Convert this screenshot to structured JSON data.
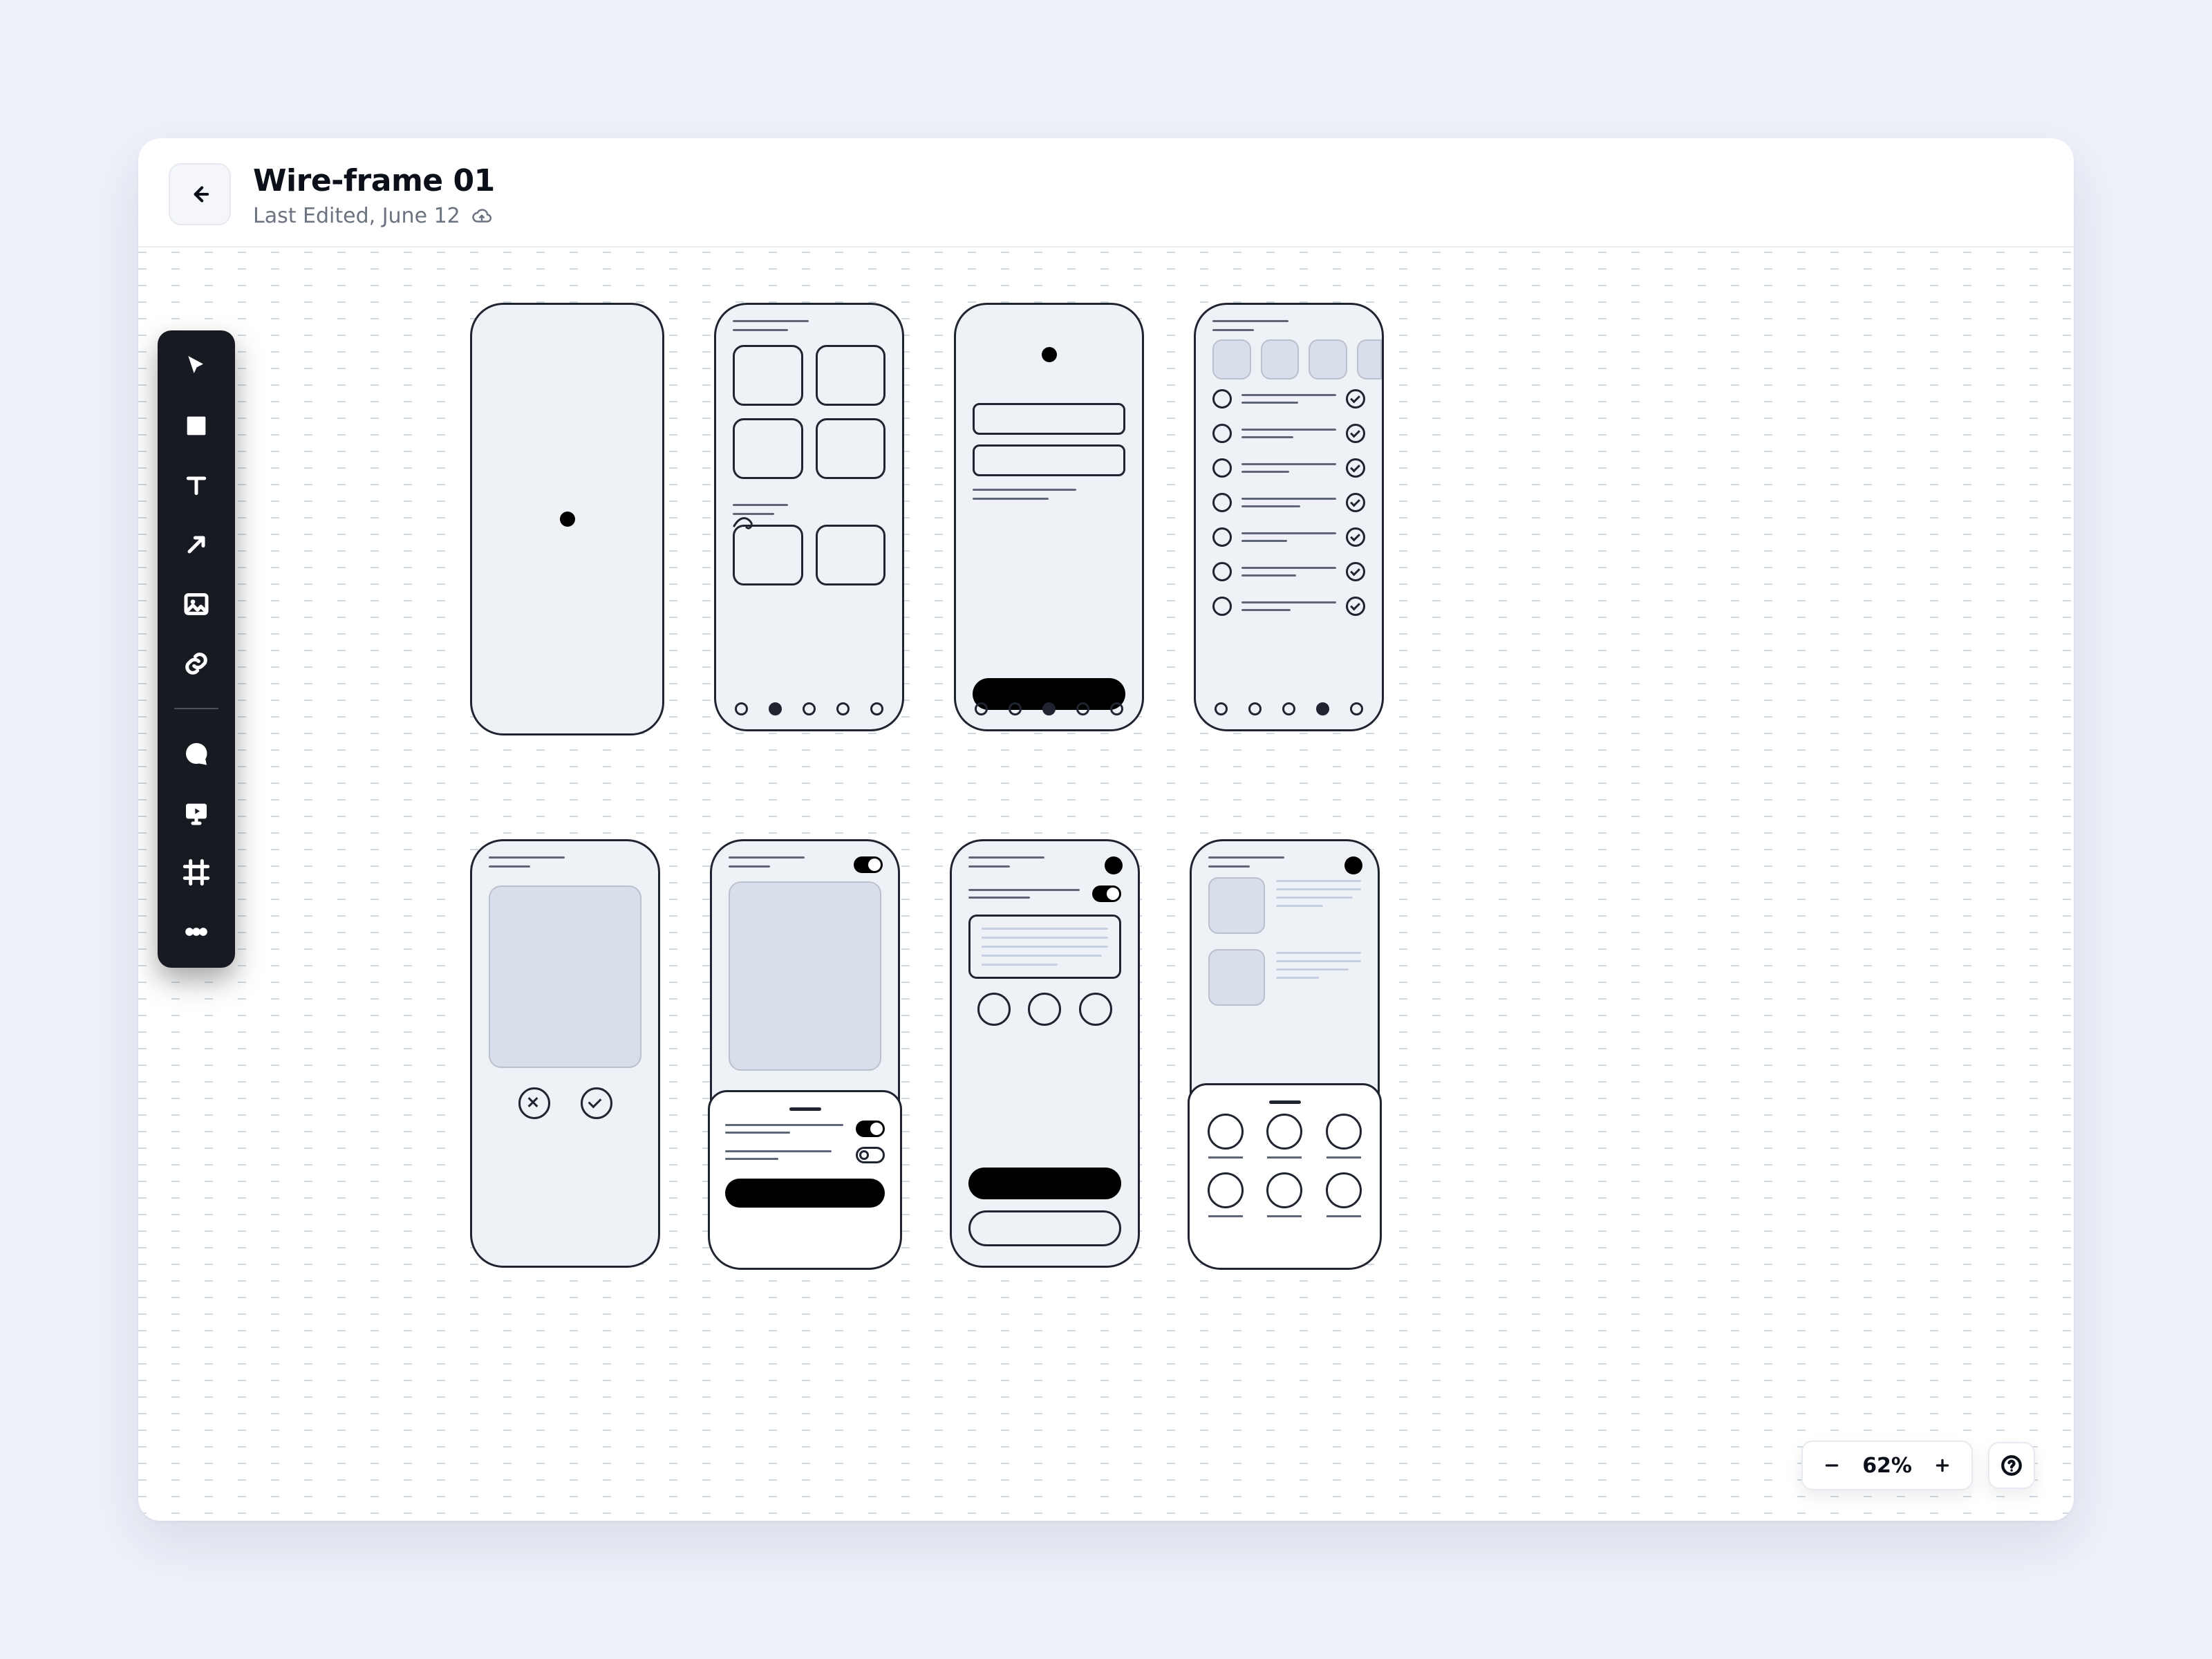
{
  "header": {
    "title": "Wire-frame 01",
    "subtitle": "Last Edited, June 12",
    "sync_icon": "cloud-upload-icon",
    "back_icon": "arrow-left-icon"
  },
  "toolbar": {
    "tools": [
      {
        "name": "select-tool",
        "icon": "cursor-arrow-icon"
      },
      {
        "name": "rectangle-tool",
        "icon": "square-icon"
      },
      {
        "name": "text-tool",
        "icon": "text-t-icon"
      },
      {
        "name": "arrow-tool",
        "icon": "arrow-upright-icon"
      },
      {
        "name": "image-tool",
        "icon": "image-icon"
      },
      {
        "name": "link-tool",
        "icon": "link-icon"
      },
      {
        "name": "separator",
        "icon": "separator"
      },
      {
        "name": "comment-tool",
        "icon": "chat-bubble-icon"
      },
      {
        "name": "video-tool",
        "icon": "play-monitor-icon"
      },
      {
        "name": "frame-tool",
        "icon": "frame-crop-icon"
      },
      {
        "name": "more-tool",
        "icon": "dots-horizontal-icon"
      }
    ]
  },
  "canvas": {
    "frames_row1": [
      {
        "name": "frame-blank",
        "pagination_active": null
      },
      {
        "name": "frame-gallery-grid",
        "pagination_active": 2
      },
      {
        "name": "frame-form-inputs",
        "pagination_active": 3
      },
      {
        "name": "frame-checklist",
        "pagination_active": 4
      }
    ],
    "frames_row2": [
      {
        "name": "frame-media-review"
      },
      {
        "name": "frame-settings-sheet"
      },
      {
        "name": "frame-article-actions"
      },
      {
        "name": "frame-feed-share-sheet"
      }
    ]
  },
  "zoom": {
    "value_label": "62%",
    "minus_icon": "minus-icon",
    "plus_icon": "plus-icon",
    "help_icon": "help-circle-icon"
  }
}
